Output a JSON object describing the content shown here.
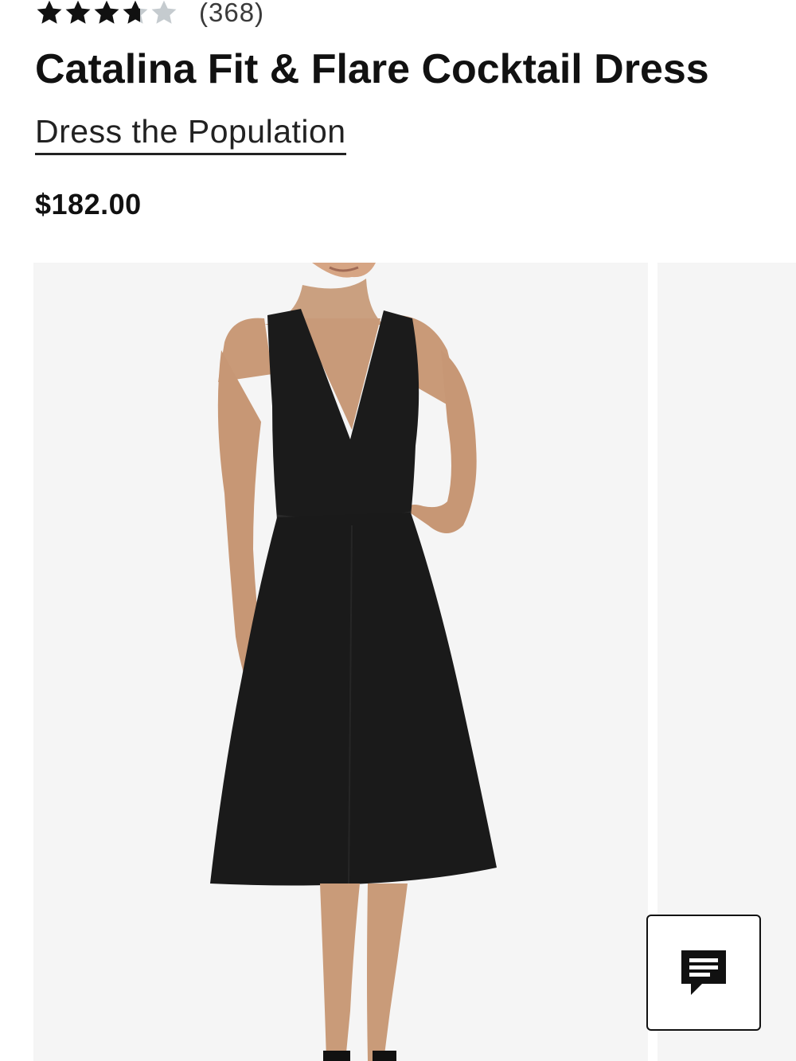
{
  "rating": {
    "stars_filled": 4,
    "stars_total": 5,
    "review_count": "(368)",
    "filled_color": "#111111",
    "empty_color": "#c5cbcf"
  },
  "product": {
    "title": "Catalina Fit & Flare Cocktail Dress",
    "brand": "Dress the Population",
    "price": "$182.00"
  },
  "gallery": {
    "main_image_icon": "product-photo-black-dress",
    "background_color": "#f5f5f5"
  },
  "chat": {
    "icon": "chat-bubble-icon"
  }
}
